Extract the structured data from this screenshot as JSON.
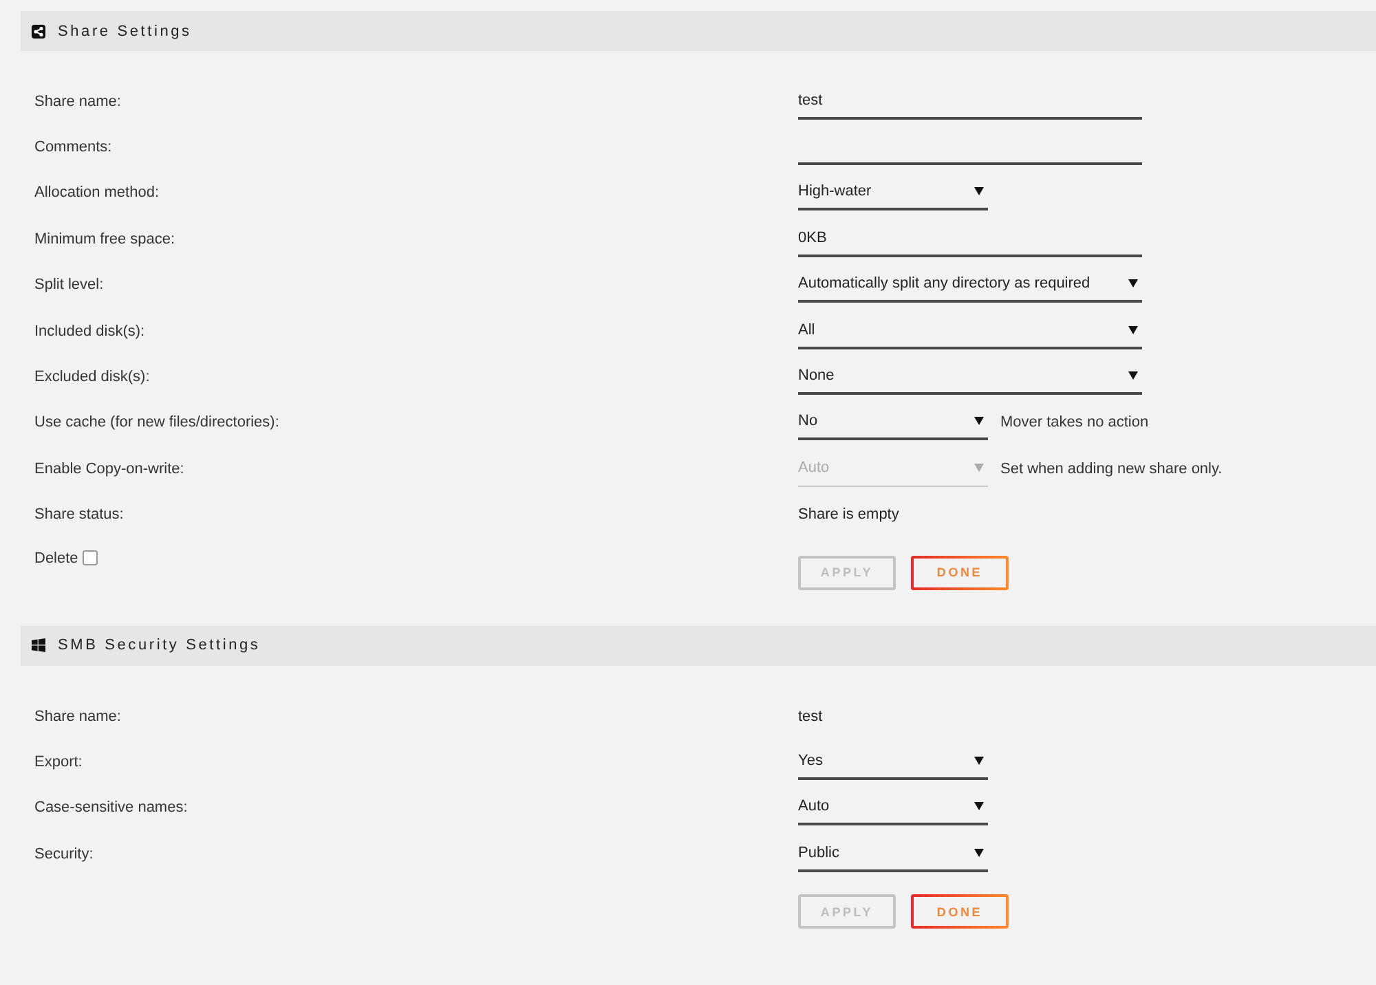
{
  "sections": [
    {
      "title": "Share Settings",
      "rows": [
        {
          "label": "Share name:",
          "kind": "input",
          "value": "test",
          "disabled": false
        },
        {
          "label": "Comments:",
          "kind": "input",
          "disabled": false
        },
        {
          "label": "Allocation method:",
          "kind": "select",
          "wide": false,
          "value": "High-water",
          "disabled": false
        },
        {
          "label": "Minimum free space:",
          "kind": "input",
          "value": "0KB",
          "disabled": false
        },
        {
          "label": "Split level:",
          "kind": "select",
          "wide": true,
          "value": "Automatically split any directory as required",
          "disabled": false
        },
        {
          "label": "Included disk(s):",
          "kind": "select",
          "wide": true,
          "value": "All",
          "disabled": false
        },
        {
          "label": "Excluded disk(s):",
          "kind": "select",
          "wide": true,
          "value": "None",
          "disabled": false
        },
        {
          "label": "Use cache (for new files/directories):",
          "kind": "select",
          "wide": false,
          "value": "No",
          "note": "Mover takes no action",
          "disabled": false
        },
        {
          "label": "Enable Copy-on-write:",
          "kind": "select",
          "wide": false,
          "value": "Auto",
          "note": "Set when adding new share only.",
          "disabled": true
        },
        {
          "label": "Share status:",
          "kind": "text",
          "value": "Share is empty",
          "disabled": false
        }
      ],
      "delete": {
        "label": "Delete",
        "checked": false
      },
      "buttons": [
        {
          "label": "APPLY",
          "disabled": true
        },
        {
          "label": "DONE",
          "disabled": false
        }
      ]
    },
    {
      "title": "SMB Security Settings",
      "rows": [
        {
          "label": "Share name:",
          "kind": "text",
          "value": "test",
          "disabled": false
        },
        {
          "label": "Export:",
          "kind": "select",
          "wide": false,
          "value": "Yes",
          "disabled": false
        },
        {
          "label": "Case-sensitive names:",
          "kind": "select",
          "wide": false,
          "value": "Auto",
          "disabled": false
        },
        {
          "label": "Security:",
          "kind": "select",
          "wide": false,
          "value": "Public",
          "disabled": false
        }
      ],
      "buttons": [
        {
          "label": "APPLY",
          "disabled": true
        },
        {
          "label": "DONE",
          "disabled": false
        }
      ]
    }
  ]
}
